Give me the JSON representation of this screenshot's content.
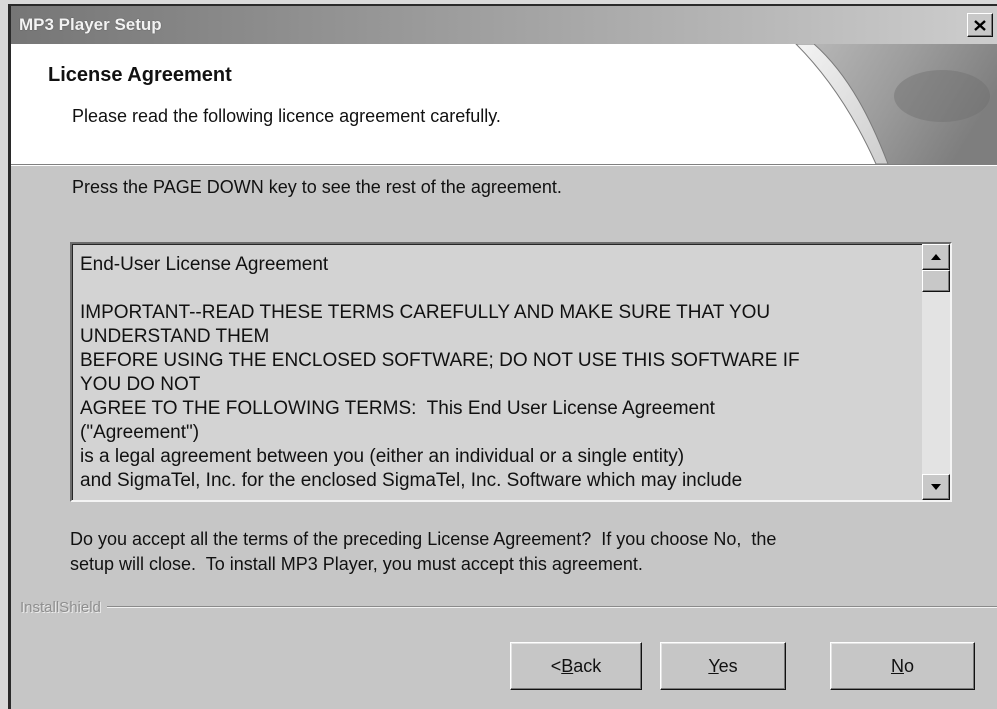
{
  "window": {
    "title": "MP3 Player Setup",
    "close_icon": "close-icon"
  },
  "header": {
    "title": "License Agreement",
    "subtitle": "Please read the following licence agreement carefully.",
    "graphic": "page-curl-graphic"
  },
  "instruction": "Press the PAGE DOWN key to see the rest of the agreement.",
  "license": {
    "heading": "End-User License Agreement",
    "lines": [
      "IMPORTANT--READ THESE TERMS CAREFULLY AND MAKE SURE THAT YOU",
      "UNDERSTAND THEM",
      "BEFORE USING THE ENCLOSED SOFTWARE; DO NOT USE THIS SOFTWARE IF",
      "YOU DO NOT",
      "AGREE TO THE FOLLOWING TERMS:  This End User License Agreement",
      "(\"Agreement\")",
      "is a legal agreement between you (either an individual or a single entity)",
      "and SigmaTel, Inc. for the enclosed SigmaTel, Inc. Software which may include"
    ],
    "scrollbar": {
      "up_icon": "scroll-up-icon",
      "down_icon": "scroll-down-icon",
      "position_fraction": 0
    }
  },
  "question": [
    "Do you accept all the terms of the preceding License Agreement?  If you choose No,  the",
    "setup will close.  To install MP3 Player, you must accept this agreement."
  ],
  "branding": "InstallShield",
  "buttons": {
    "back": {
      "arrow": "<",
      "label": "Back"
    },
    "yes": {
      "label": "Yes"
    },
    "no": {
      "label": "No"
    }
  },
  "colors": {
    "title_bar_left": "#767676",
    "title_bar_right": "#cdcdcd",
    "dialog_face": "#c6c6c6",
    "header_background": "#ffffff",
    "text": "#111111"
  }
}
